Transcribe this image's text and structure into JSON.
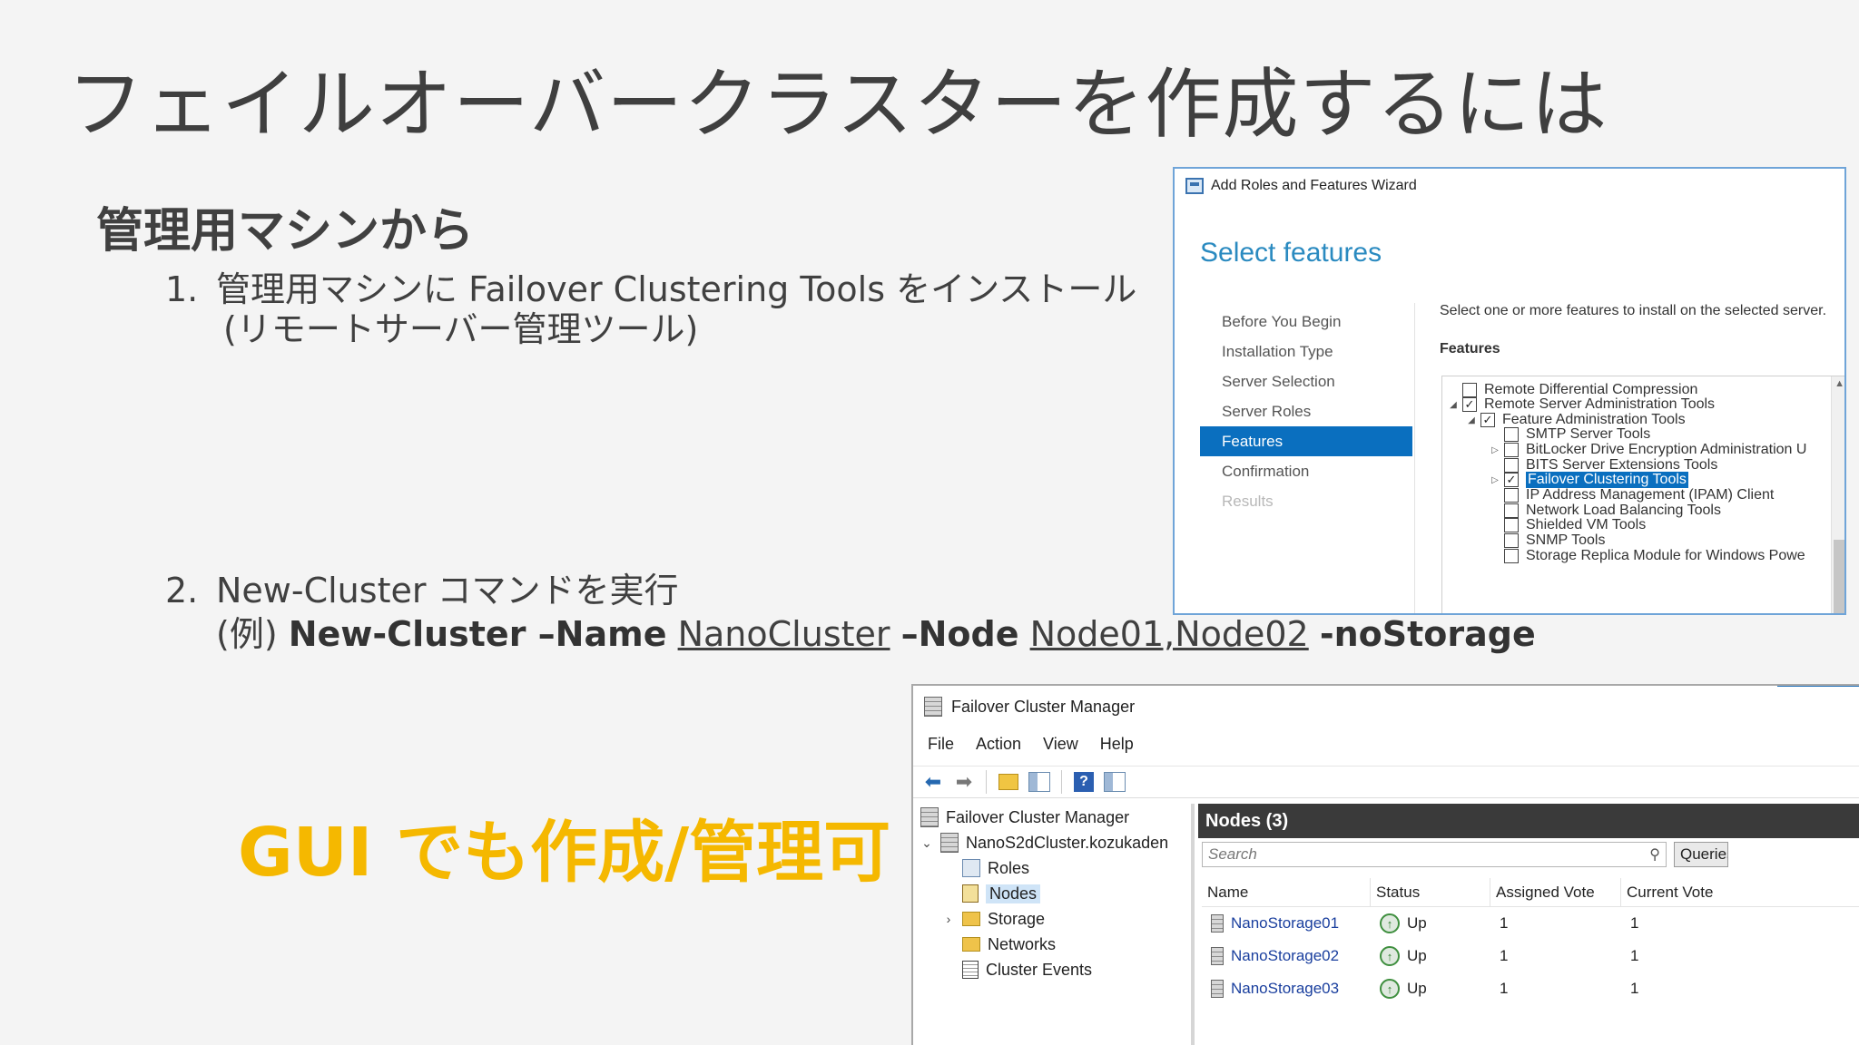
{
  "slide": {
    "title": "フェイルオーバークラスターを作成するには",
    "heading": "管理用マシンから",
    "step1": {
      "number": "1.",
      "text": "管理用マシンに Failover Clustering Tools をインストール",
      "sub": "(リモートサーバー管理ツール)"
    },
    "step2": {
      "number": "2.",
      "text": "New-Cluster コマンドを実行",
      "example_prefix": "(例) ",
      "cmd1": "New-Cluster –Name",
      "arg1": "NanoCluster",
      "cmd2": "–Node",
      "arg2": "Node01,Node02",
      "cmd3": "-noStorage"
    },
    "gui_note": "GUI でも作成/管理可",
    "accent_color": "#f5b800"
  },
  "wizard": {
    "window_title": "Add Roles and Features Wizard",
    "heading": "Select features",
    "nav": [
      "Before You Begin",
      "Installation Type",
      "Server Selection",
      "Server Roles",
      "Features",
      "Confirmation",
      "Results"
    ],
    "active_nav": "Features",
    "description": "Select one or more features to install on the selected server.",
    "features_label": "Features",
    "tree": [
      {
        "label": "Remote Differential Compression",
        "checked": false
      },
      {
        "label": "Remote Server Administration Tools",
        "checked": true
      },
      {
        "label": "Feature Administration Tools",
        "checked": true
      },
      {
        "label": "SMTP Server Tools",
        "checked": false
      },
      {
        "label": "BitLocker Drive Encryption Administration U",
        "checked": false
      },
      {
        "label": "BITS Server Extensions Tools",
        "checked": false
      },
      {
        "label": "Failover Clustering Tools",
        "checked": true
      },
      {
        "label": "IP Address Management (IPAM) Client",
        "checked": false
      },
      {
        "label": "Network Load Balancing Tools",
        "checked": false
      },
      {
        "label": "Shielded VM Tools",
        "checked": false
      },
      {
        "label": "SNMP Tools",
        "checked": false
      },
      {
        "label": "Storage Replica Module for Windows Powe",
        "checked": false
      }
    ],
    "accent": "#0a6fbf"
  },
  "fcm": {
    "window_title": "Failover Cluster Manager",
    "menu": [
      "File",
      "Action",
      "View",
      "Help"
    ],
    "tree": {
      "root": "Failover Cluster Manager",
      "cluster": "NanoS2dCluster.kozukaden",
      "items": [
        "Roles",
        "Nodes",
        "Storage",
        "Networks",
        "Cluster Events"
      ]
    },
    "pane_title": "Nodes (3)",
    "search_placeholder": "Search",
    "query_label": "Queries",
    "columns": [
      "Name",
      "Status",
      "Assigned Vote",
      "Current Vote"
    ],
    "rows": [
      {
        "name": "NanoStorage01",
        "status": "Up",
        "assigned": "1",
        "current": "1"
      },
      {
        "name": "NanoStorage02",
        "status": "Up",
        "assigned": "1",
        "current": "1"
      },
      {
        "name": "NanoStorage03",
        "status": "Up",
        "assigned": "1",
        "current": "1"
      }
    ]
  }
}
